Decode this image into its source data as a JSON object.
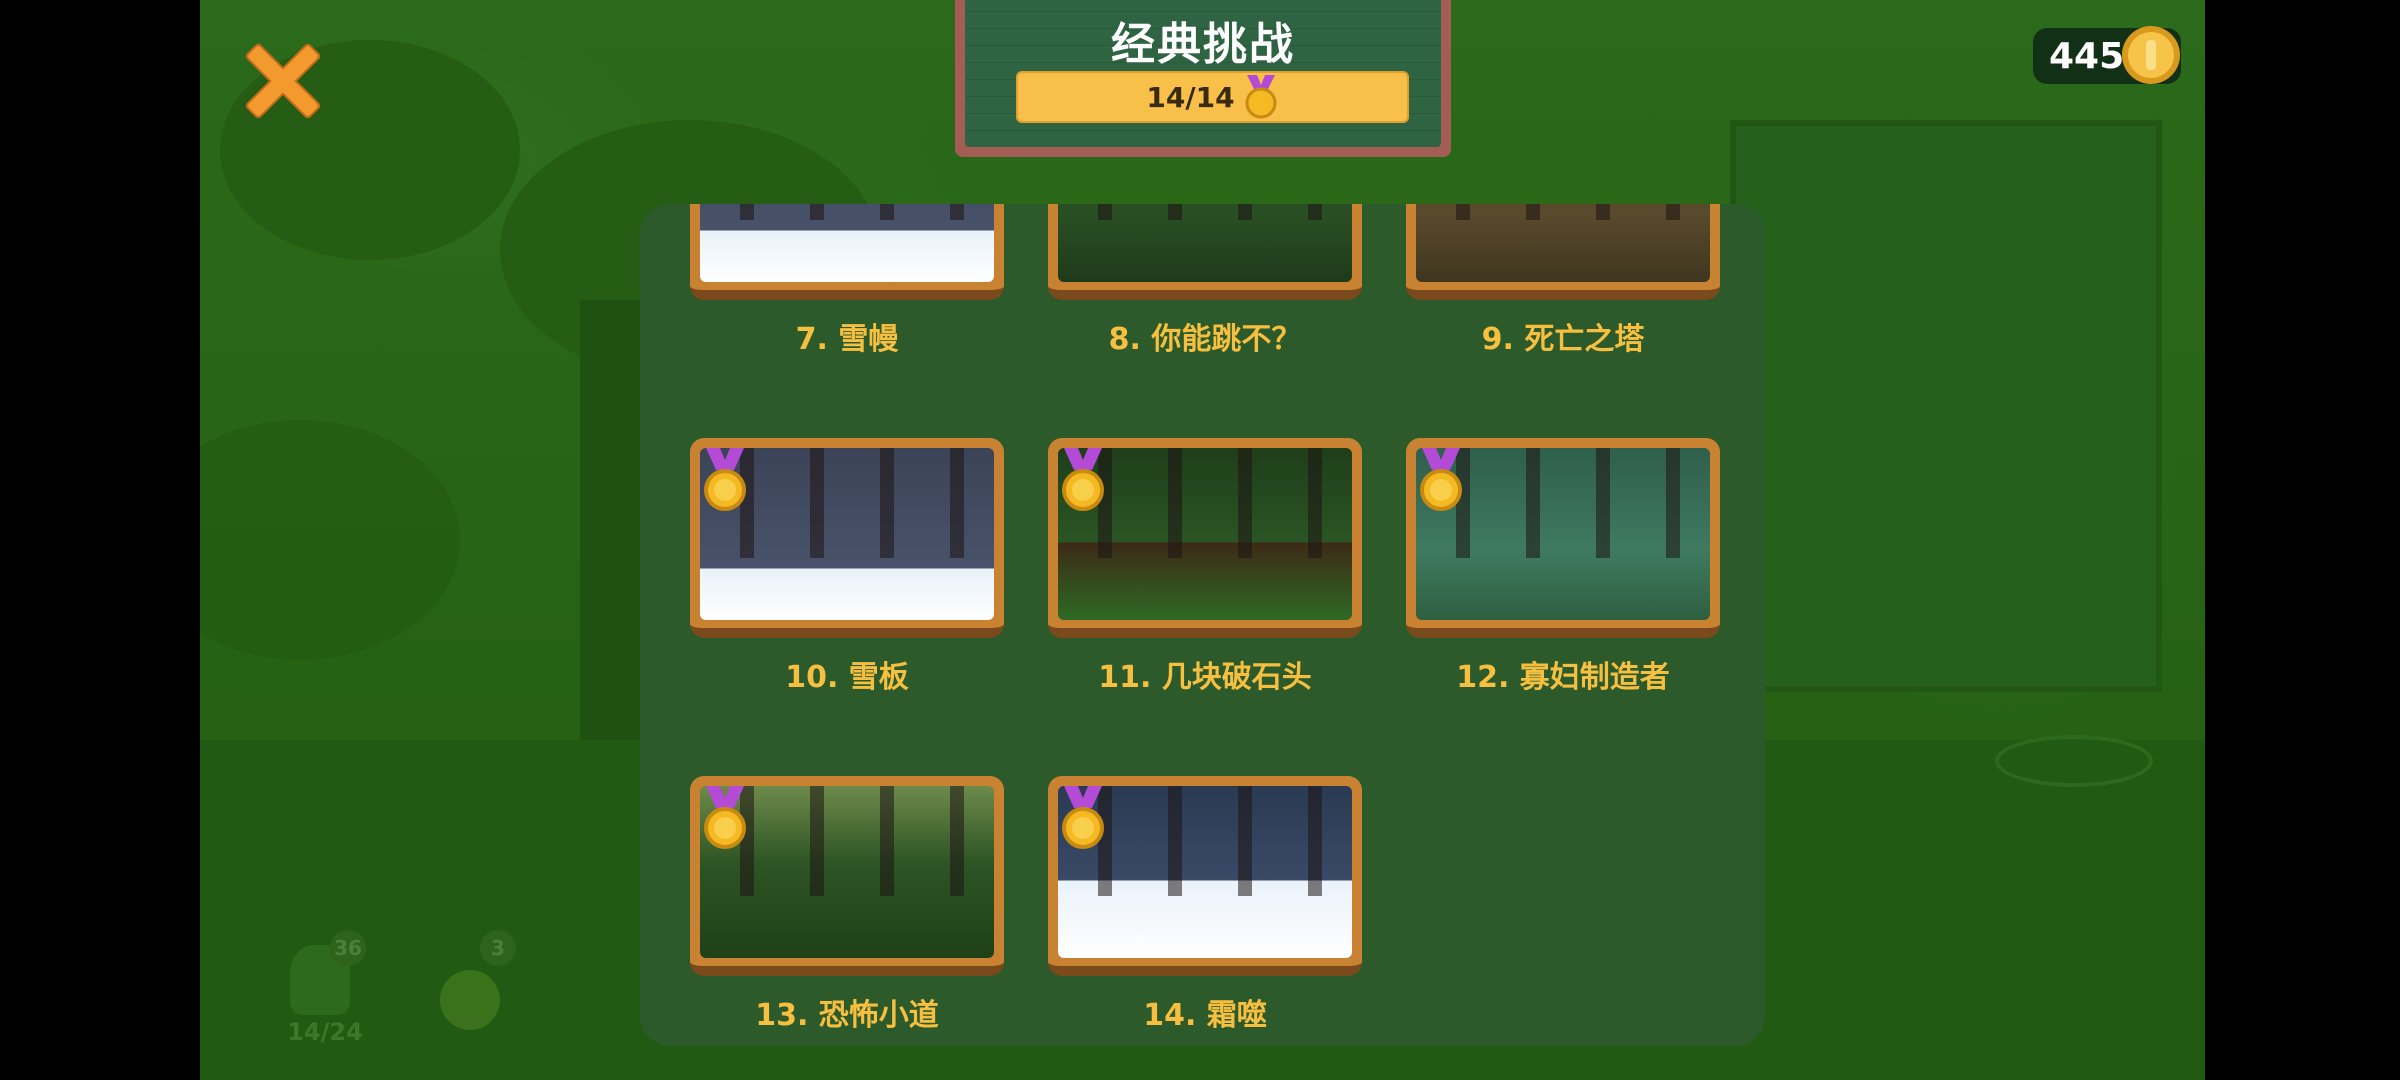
{
  "header": {
    "title": "经典挑战",
    "progress_text": "14/14",
    "progress": 1.0
  },
  "coins": {
    "count": "445"
  },
  "icons": {
    "close": "close-x-icon",
    "coin": "gold-coin-icon",
    "medal": "gold-medal-icon"
  },
  "colors": {
    "accent_gold": "#f6bf3f",
    "panel": "#2c5a2a",
    "board": "#2f6442",
    "frame": "#c98231"
  },
  "levels": [
    {
      "label": "7. 雪幔",
      "medal": false,
      "scene": "snow-night"
    },
    {
      "label": "8. 你能跳不？",
      "medal": false,
      "scene": "forest-red"
    },
    {
      "label": "9. 死亡之塔",
      "medal": false,
      "scene": "brown-tower"
    },
    {
      "label": "10. 雪板",
      "medal": true,
      "scene": "snow-night"
    },
    {
      "label": "11. 几块破石头",
      "medal": true,
      "scene": "forest-green"
    },
    {
      "label": "12. 寡妇制造者",
      "medal": true,
      "scene": "pine-hill"
    },
    {
      "label": "13. 恐怖小道",
      "medal": true,
      "scene": "jungle"
    },
    {
      "label": "14. 霜噬",
      "medal": true,
      "scene": "snow-catapult"
    }
  ],
  "background_badges": {
    "left_count": "36",
    "left_progress": "14/24",
    "right_count": "3"
  }
}
